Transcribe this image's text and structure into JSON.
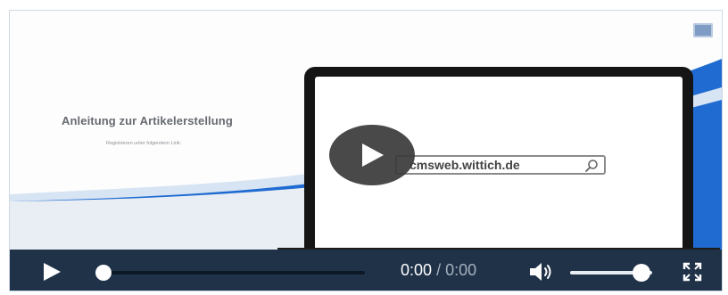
{
  "slide": {
    "title": "Anleitung zur Artikelerstellung",
    "subtitle": "Registrieren unter folgendem Link:",
    "laptop_url": "cmsweb.wittich.de"
  },
  "player": {
    "current_time": "0:00",
    "separator": "/",
    "duration": "0:00",
    "progress": 0,
    "volume": 0.85
  },
  "colors": {
    "control_bar": "#1f3248",
    "accent_wave": "#1f6bd1"
  },
  "icons": [
    "play-icon",
    "volume-icon",
    "fullscreen-icon",
    "search-icon"
  ]
}
